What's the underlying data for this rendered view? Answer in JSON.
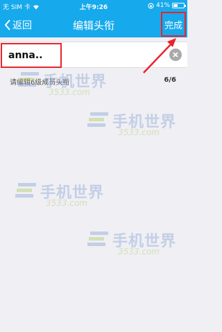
{
  "status": {
    "carrier": "无 SIM 卡",
    "time": "上午9:26",
    "battery_percent": "41%",
    "battery_level": 0.41
  },
  "nav": {
    "back_label": "返回",
    "title": "编辑头衔",
    "done_label": "完成"
  },
  "input": {
    "value": "anna.."
  },
  "hint": {
    "text": "请编辑6级成员头衔",
    "count": "6/6"
  },
  "watermark": {
    "name": "手机世界",
    "site": "3533.com"
  },
  "colors": {
    "header": "#16a9ec",
    "highlight": "#e8232a",
    "background": "#efeff4"
  }
}
